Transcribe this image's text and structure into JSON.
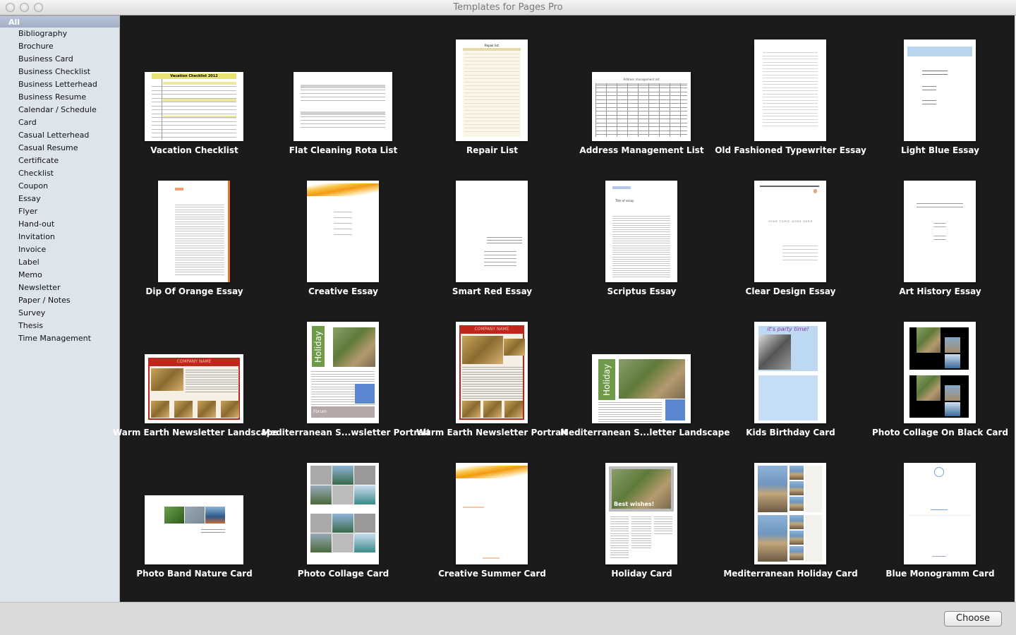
{
  "window": {
    "title": "Templates for Pages Pro"
  },
  "sidebar": {
    "selected": "All",
    "items": [
      "Bibliography",
      "Brochure",
      "Business Card",
      "Business Checklist",
      "Business Letterhead",
      "Business Resume",
      "Calendar / Schedule",
      "Card",
      "Casual Letterhead",
      "Casual Resume",
      "Certificate",
      "Checklist",
      "Coupon",
      "Essay",
      "Flyer",
      "Hand-out",
      "Invitation",
      "Invoice",
      "Label",
      "Memo",
      "Newsletter",
      "Paper / Notes",
      "Survey",
      "Thesis",
      "Time Management"
    ]
  },
  "templates": [
    {
      "name": "Vacation Checklist",
      "orientation": "landscape",
      "style": "vacation",
      "thumb_heading": "Vacation Checklist 2012"
    },
    {
      "name": "Flat Cleaning Rota List",
      "orientation": "landscape",
      "style": "tables"
    },
    {
      "name": "Repair List",
      "orientation": "portrait",
      "style": "repair",
      "thumb_heading": "Repair list"
    },
    {
      "name": "Address Management List",
      "orientation": "landscape",
      "style": "address",
      "thumb_heading": "Address management list"
    },
    {
      "name": "Old Fashioned Typewriter Essay",
      "orientation": "portrait",
      "style": "text"
    },
    {
      "name": "Light Blue Essay",
      "orientation": "portrait",
      "style": "lightblue"
    },
    {
      "name": "Dip Of Orange Essay",
      "orientation": "portrait",
      "style": "orange"
    },
    {
      "name": "Creative Essay",
      "orientation": "portrait",
      "style": "wave"
    },
    {
      "name": "Smart Red Essay",
      "orientation": "portrait",
      "style": "smartred"
    },
    {
      "name": "Scriptus Essay",
      "orientation": "portrait",
      "style": "scriptus",
      "thumb_heading": "Title of essay"
    },
    {
      "name": "Clear Design Essay",
      "orientation": "portrait",
      "style": "clear",
      "thumb_heading": "YOUR TOPIC GOES HERE"
    },
    {
      "name": "Art History Essay",
      "orientation": "portrait",
      "style": "arthistory"
    },
    {
      "name": "Warm Earth Newsletter Landscape",
      "orientation": "landscape",
      "style": "warmearth",
      "thumb_heading": "COMPANY NAME"
    },
    {
      "name": "Mediterranean S...wsletter Portrait",
      "orientation": "portrait",
      "style": "medport",
      "thumb_heading": "Holiday",
      "thumb_footer": "Forum"
    },
    {
      "name": "Warm Earth Newsletter Portrait",
      "orientation": "portrait",
      "style": "warmearth",
      "thumb_heading": "COMPANY NAME"
    },
    {
      "name": "Mediterranean S...letter Landscape",
      "orientation": "landscape",
      "style": "medland",
      "thumb_heading": "Holiday"
    },
    {
      "name": "Kids Birthday Card",
      "orientation": "portrait",
      "style": "kids",
      "thumb_heading": "it's party time!"
    },
    {
      "name": "Photo Collage On Black Card",
      "orientation": "portrait",
      "style": "black"
    },
    {
      "name": "Photo Band Nature Card",
      "orientation": "landscape",
      "style": "band"
    },
    {
      "name": "Photo Collage Card",
      "orientation": "portrait",
      "style": "collage"
    },
    {
      "name": "Creative Summer Card",
      "orientation": "portrait",
      "style": "summer"
    },
    {
      "name": "Holiday Card",
      "orientation": "portrait",
      "style": "holiday",
      "thumb_heading": "Best wishes!"
    },
    {
      "name": "Mediterranean Holiday Card",
      "orientation": "portrait",
      "style": "medcard"
    },
    {
      "name": "Blue Monogramm Card",
      "orientation": "portrait",
      "style": "monogram"
    }
  ],
  "footer": {
    "choose_label": "Choose"
  },
  "colors": {
    "grid_background": "#1b1b1b",
    "sidebar_background": "#dde4ec",
    "sidebar_selected": "#a9b5cb",
    "warm_earth_red": "#c0261c",
    "mediterranean_green": "#6f9a4a",
    "accent_blue": "#5b86d0",
    "orange": "#f0a020"
  }
}
